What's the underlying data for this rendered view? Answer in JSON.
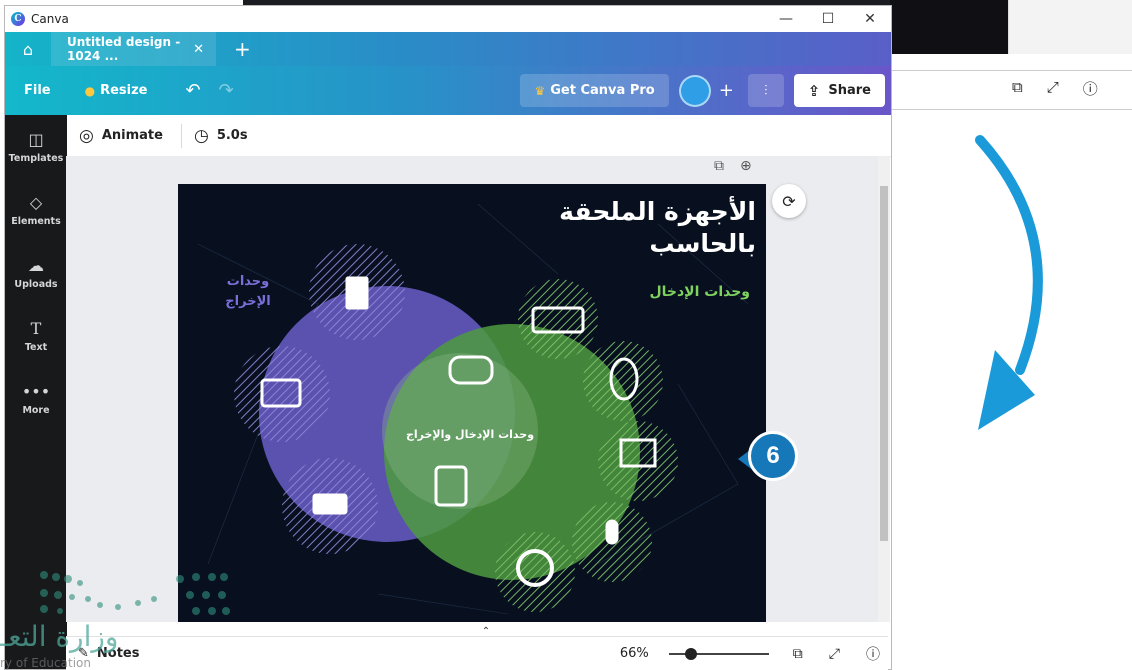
{
  "window": {
    "app_name": "Canva",
    "logo_letter": "C"
  },
  "tabs": [
    {
      "label": "Untitled design - 1024 ..."
    }
  ],
  "toolbar": {
    "file_label": "File",
    "resize_label": "Resize",
    "get_pro_label": "Get Canva Pro",
    "share_label": "Share",
    "brand_color": "#14b4c9",
    "accent_color": "#6a56c9"
  },
  "sidebar": {
    "items": [
      {
        "label": "Templates",
        "icon": "templates-icon"
      },
      {
        "label": "Elements",
        "icon": "elements-icon"
      },
      {
        "label": "Uploads",
        "icon": "uploads-icon"
      },
      {
        "label": "Text",
        "icon": "text-icon"
      },
      {
        "label": "More",
        "icon": "more-icon"
      }
    ]
  },
  "subbar": {
    "animate_label": "Animate",
    "duration_label": "5.0s"
  },
  "design": {
    "title": "الأجهزة الملحقة بالحاسب",
    "input_label": "وحدات الإدخال",
    "output_label": "وحدات الإخراج",
    "io_label": "وحدات الإدخال والإخراج",
    "output_color": "#5b52b0",
    "input_color": "#4e9a3f"
  },
  "bottombar": {
    "notes_label": "Notes",
    "zoom_label": "66%",
    "zoom_level_percent": 66
  },
  "badge": {
    "number": "6",
    "color": "#1677b9"
  },
  "watermark": {
    "text": "وزارة التعـ",
    "subtext": "ry of Education"
  }
}
